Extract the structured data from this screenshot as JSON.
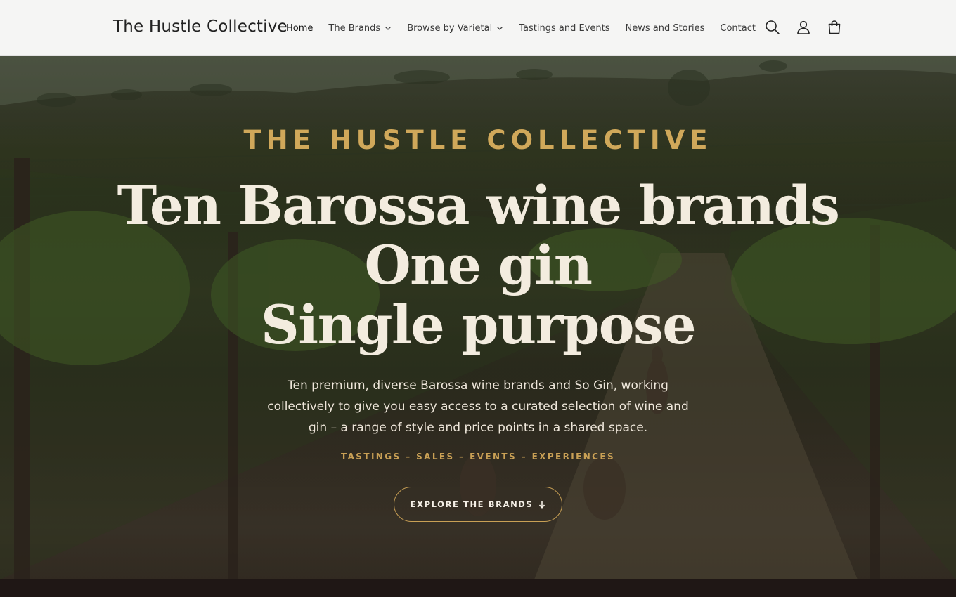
{
  "header": {
    "logo": "The Hustle Collective",
    "nav": [
      {
        "label": "Home",
        "active": true,
        "dropdown": false
      },
      {
        "label": "The Brands",
        "active": false,
        "dropdown": true
      },
      {
        "label": "Browse by Varietal",
        "active": false,
        "dropdown": true
      },
      {
        "label": "Tastings and Events",
        "active": false,
        "dropdown": false
      },
      {
        "label": "News and Stories",
        "active": false,
        "dropdown": false
      },
      {
        "label": "Contact",
        "active": false,
        "dropdown": false
      }
    ],
    "icons": [
      "search-icon",
      "account-icon",
      "cart-icon"
    ]
  },
  "hero": {
    "eyebrow": "THE HUSTLE COLLECTIVE",
    "headline": [
      "Ten Barossa wine brands",
      "One gin",
      "Single purpose"
    ],
    "subtext": "Ten premium, diverse Barossa wine brands and So Gin, working collectively to give you easy access to a curated selection of wine and gin – a range of style and price points in a shared space.",
    "tagline": "TASTINGS – SALES – EVENTS – EXPERIENCES",
    "cta_label": "EXPLORE THE BRANDS",
    "cta_icon": "arrow-down-icon"
  },
  "colors": {
    "accent_gold": "#d0a85a",
    "headline_cream": "#f3ecdf",
    "header_bg": "#f5f5f4",
    "footer_dark": "#1f1715"
  }
}
